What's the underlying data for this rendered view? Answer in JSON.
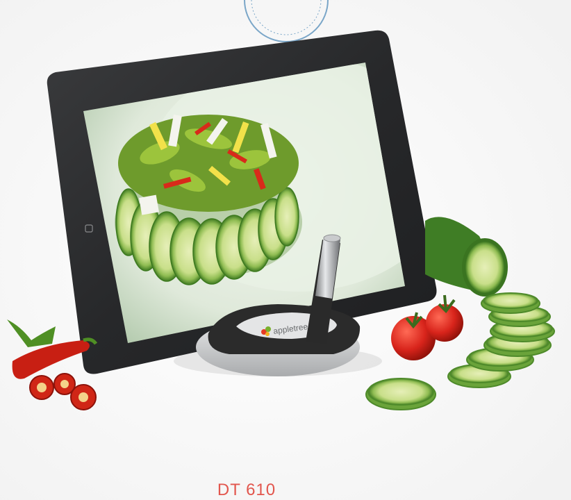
{
  "product": {
    "code": "DT 610",
    "logo_text": "appletree.com"
  },
  "colors": {
    "code_text": "#e2564d",
    "stand_dark": "#2b2b2b",
    "tablet_frame": "#2e2f31",
    "cucumber": "#7fae4a",
    "pepper": "#c81f13"
  }
}
